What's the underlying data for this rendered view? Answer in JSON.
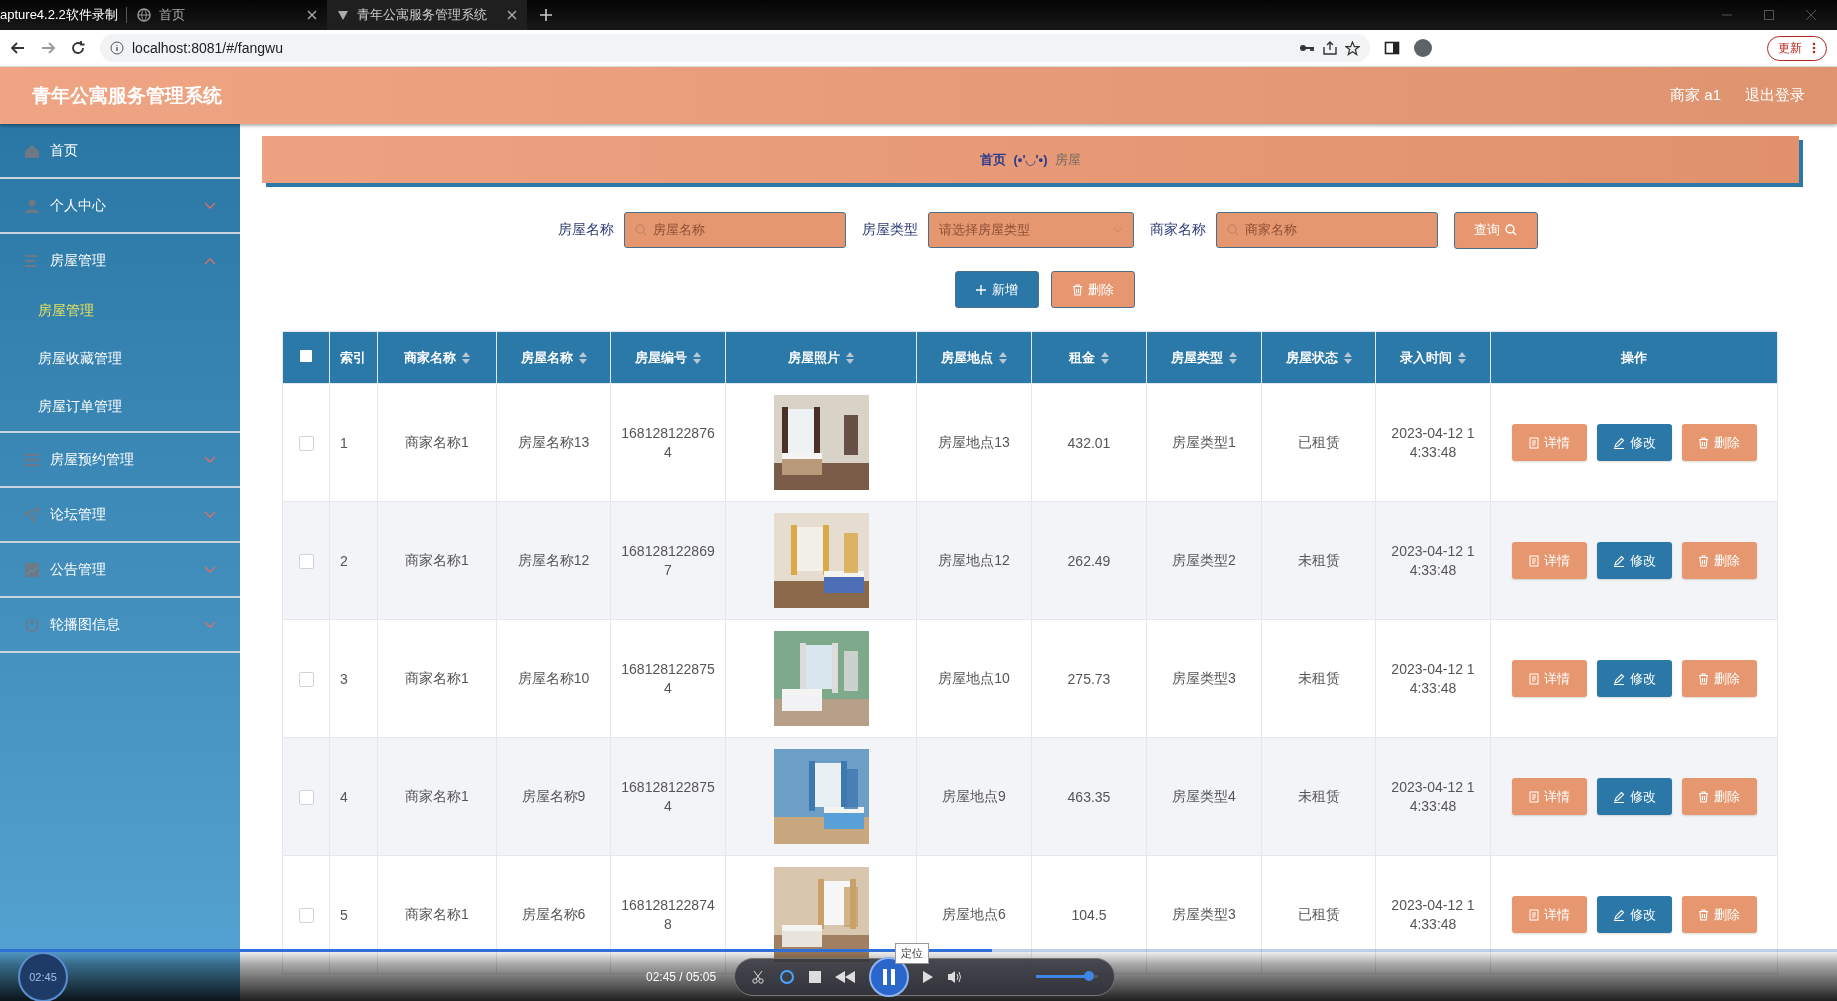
{
  "browser": {
    "recorder_title": "apture4.2.2软件录制",
    "tabs": [
      {
        "label": "首页",
        "selected": false
      },
      {
        "label": "青年公寓服务管理系统",
        "selected": true
      }
    ],
    "address": "localhost:8081/#/fangwu",
    "update_button": "更新"
  },
  "header": {
    "title": "青年公寓服务管理系统",
    "user": "商家 a1",
    "logout": "退出登录"
  },
  "sidebar": {
    "items": [
      {
        "label": "首页",
        "kind": "link"
      },
      {
        "label": "个人中心",
        "kind": "group",
        "expanded": false
      },
      {
        "label": "房屋管理",
        "kind": "group",
        "expanded": true,
        "children": [
          {
            "label": "房屋管理",
            "selected": true
          },
          {
            "label": "房屋收藏管理",
            "selected": false
          },
          {
            "label": "房屋订单管理",
            "selected": false
          }
        ]
      },
      {
        "label": "房屋预约管理",
        "kind": "group",
        "expanded": false
      },
      {
        "label": "论坛管理",
        "kind": "group",
        "expanded": false
      },
      {
        "label": "公告管理",
        "kind": "group",
        "expanded": false
      },
      {
        "label": "轮播图信息",
        "kind": "group",
        "expanded": false
      }
    ]
  },
  "breadcrumb": [
    "首页",
    "(•'◡'•)",
    "房屋"
  ],
  "search": {
    "fields": [
      {
        "label": "房屋名称",
        "placeholder": "房屋名称",
        "kind": "input"
      },
      {
        "label": "房屋类型",
        "placeholder": "请选择房屋类型",
        "kind": "select"
      },
      {
        "label": "商家名称",
        "placeholder": "商家名称",
        "kind": "input"
      }
    ],
    "button": "查询"
  },
  "actions": [
    {
      "label": "新增",
      "kind": "add"
    },
    {
      "label": "删除",
      "kind": "delete"
    }
  ],
  "table": {
    "all_checked": false,
    "columns": [
      {
        "label": "索引",
        "kind": "text",
        "sortable": false
      },
      {
        "label": "商家名称",
        "kind": "text",
        "sortable": true
      },
      {
        "label": "房屋名称",
        "kind": "text",
        "sortable": true
      },
      {
        "label": "房屋编号",
        "kind": "text",
        "sortable": true
      },
      {
        "label": "房屋照片",
        "sortable": true
      },
      {
        "label": "房屋地点",
        "kind": "text",
        "sortable": true
      },
      {
        "label": "租金",
        "kind": "text",
        "sortable": true
      },
      {
        "label": "房屋类型",
        "kind": "text",
        "sortable": true
      },
      {
        "label": "房屋状态",
        "kind": "text",
        "sortable": true
      },
      {
        "label": "录入时间",
        "kind": "text",
        "sortable": true
      },
      {
        "label": "操作",
        "kind": "actions",
        "sortable": false
      }
    ],
    "rows": [
      {
        "checked": false,
        "cells": [
          "1",
          "商家名称1",
          "房屋名称13",
          "1681281228764",
          "",
          "房屋地点13",
          "432.01",
          "房屋类型1",
          "已租赁",
          "2023-04-12 14:33:48"
        ],
        "buttons": [
          "详情",
          "修改",
          "删除"
        ]
      },
      {
        "checked": false,
        "cells": [
          "2",
          "商家名称1",
          "房屋名称12",
          "1681281228697",
          "",
          "房屋地点12",
          "262.49",
          "房屋类型2",
          "未租赁",
          "2023-04-12 14:33:48"
        ],
        "buttons": [
          "详情",
          "修改",
          "删除"
        ]
      },
      {
        "checked": false,
        "cells": [
          "3",
          "商家名称1",
          "房屋名称10",
          "1681281228754",
          "",
          "房屋地点10",
          "275.73",
          "房屋类型3",
          "未租赁",
          "2023-04-12 14:33:48"
        ],
        "buttons": [
          "详情",
          "修改",
          "删除"
        ]
      },
      {
        "checked": false,
        "cells": [
          "4",
          "商家名称1",
          "房屋名称9",
          "1681281228754",
          "",
          "房屋地点9",
          "463.35",
          "房屋类型4",
          "未租赁",
          "2023-04-12 14:33:48"
        ],
        "buttons": [
          "详情",
          "修改",
          "删除"
        ]
      },
      {
        "checked": false,
        "cells": [
          "5",
          "商家名称1",
          "房屋名称6",
          "1681281228748",
          "",
          "房屋地点6",
          "104.5",
          "房屋类型3",
          "已租赁",
          "2023-04-12 14:33:48"
        ],
        "buttons": [
          "详情",
          "修改",
          "删除"
        ]
      }
    ]
  },
  "player": {
    "badge": "02:45",
    "time": "02:45 / 05:05",
    "tooltip": "定位",
    "playing": true,
    "progress": {
      "level": 0.54
    },
    "volume": {
      "level": 0.85
    }
  }
}
